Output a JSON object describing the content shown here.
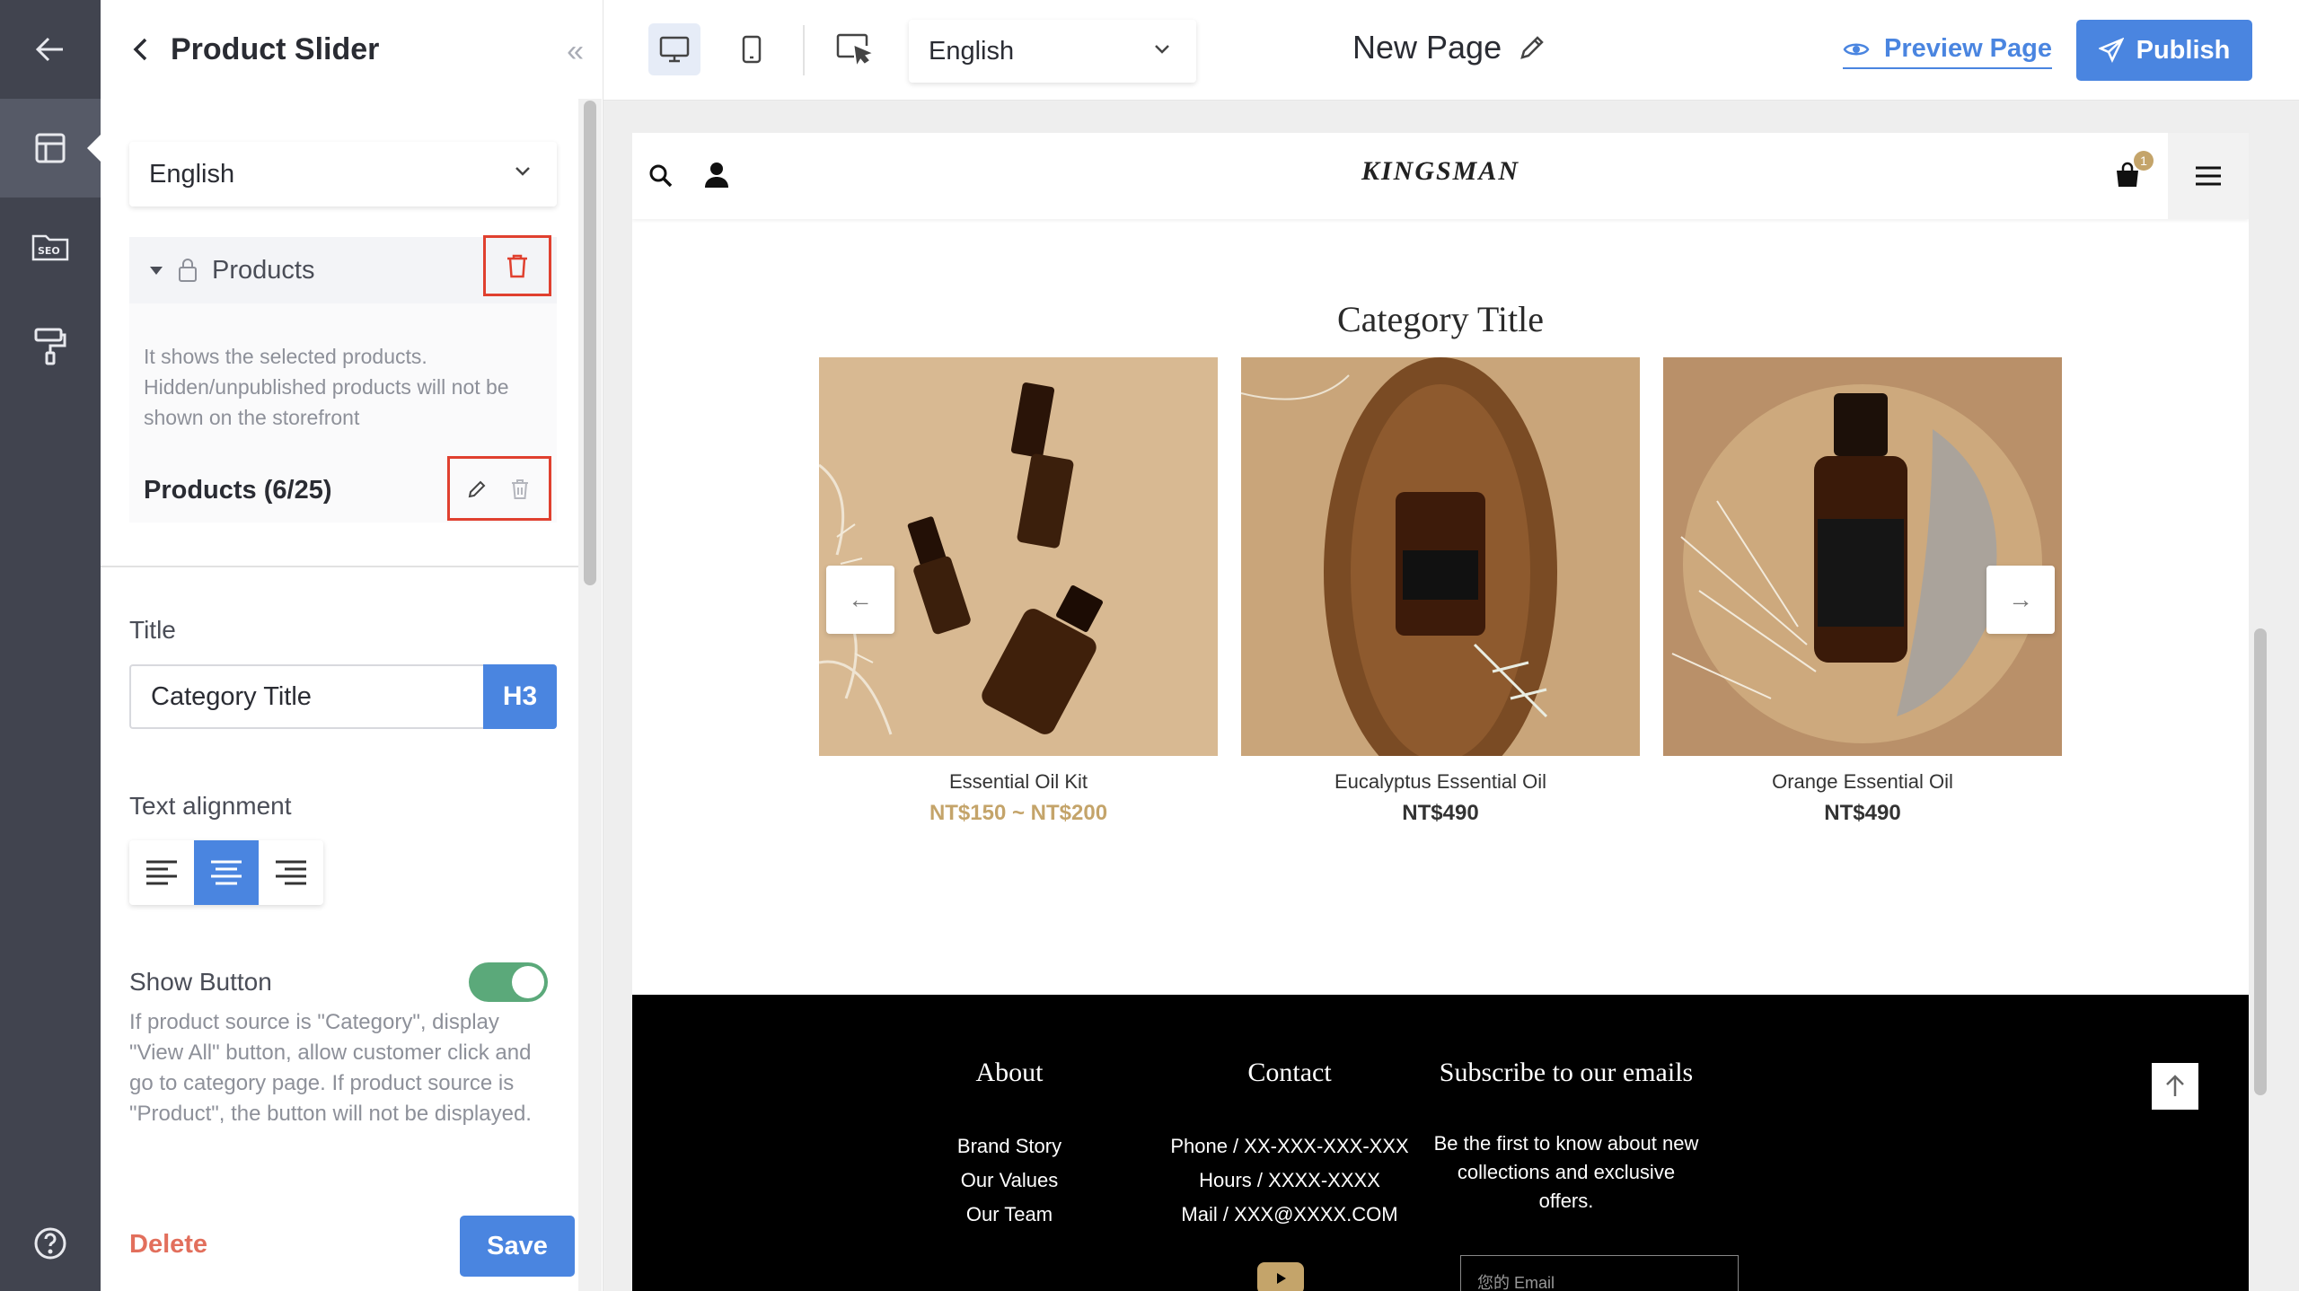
{
  "panel": {
    "title": "Product Slider",
    "language": "English",
    "products_header": "Products",
    "products_desc": "It shows the selected products. Hidden/unpublished products will not be shown on the storefront",
    "products_count": "Products (6/25)",
    "title_label": "Title",
    "title_value": "Category Title",
    "heading_level": "H3",
    "text_alignment_label": "Text alignment",
    "alignment_selected": "center",
    "show_button_label": "Show Button",
    "show_button_on": true,
    "show_button_help": "If product source is \"Category\", display \"View All\" button, allow customer click and go to category page. If product source is \"Product\", the button will not be displayed.",
    "delete_label": "Delete",
    "save_label": "Save"
  },
  "toolbar": {
    "language": "English",
    "page_title": "New Page",
    "preview_label": "Preview Page",
    "publish_label": "Publish"
  },
  "preview": {
    "brand": "KINGSMAN",
    "cart_count": "1",
    "section_title": "Category Title",
    "products": [
      {
        "name": "Essential Oil Kit",
        "price": "NT$150 ~ NT$200",
        "sale": true
      },
      {
        "name": "Eucalyptus Essential Oil",
        "price": "NT$490",
        "sale": false
      },
      {
        "name": "Orange Essential Oil",
        "price": "NT$490",
        "sale": false
      }
    ],
    "footer": {
      "about_title": "About",
      "about_links": [
        "Brand Story",
        "Our Values",
        "Our Team"
      ],
      "contact_title": "Contact",
      "contact_lines": [
        "Phone / XX-XXX-XXX-XXX",
        "Hours / XXXX-XXXX",
        "Mail / XXX@XXXX.COM"
      ],
      "subscribe_title": "Subscribe to our emails",
      "subscribe_text": "Be the first to know about new collections and exclusive offers.",
      "email_placeholder": "您的 Email"
    }
  },
  "colors": {
    "rail": "#41444f",
    "accent": "#4a85e0",
    "highlight_box": "#e0402f",
    "toggle_on": "#5ba97a",
    "price_gold": "#c4a46a"
  }
}
